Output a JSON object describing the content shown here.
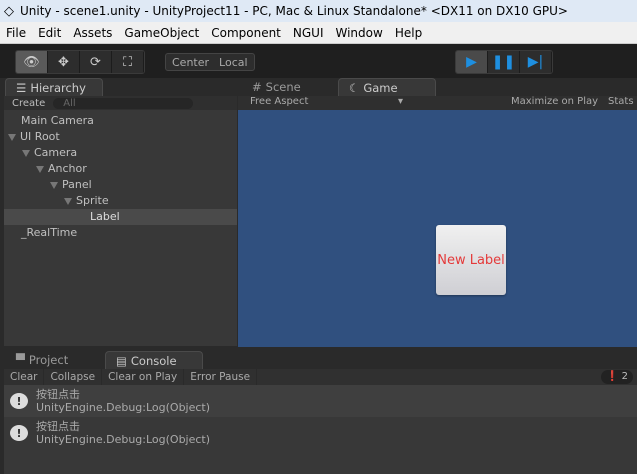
{
  "title": "Unity - scene1.unity - UnityProject11 - PC, Mac & Linux Standalone* <DX11 on DX10 GPU>",
  "menu": [
    "File",
    "Edit",
    "Assets",
    "GameObject",
    "Component",
    "NGUI",
    "Window",
    "Help"
  ],
  "toolbar": {
    "pivot": "Center",
    "space": "Local"
  },
  "hierarchy": {
    "tab": "Hierarchy",
    "create": "Create",
    "search_placeholder": "All",
    "items": [
      {
        "label": "Main Camera"
      },
      {
        "label": "UI Root"
      },
      {
        "label": "Camera"
      },
      {
        "label": "Anchor"
      },
      {
        "label": "Panel"
      },
      {
        "label": "Sprite"
      },
      {
        "label": "Label"
      },
      {
        "label": "_RealTime"
      }
    ]
  },
  "scene_tab": "Scene",
  "game_tab": "Game",
  "game": {
    "aspect": "Free Aspect",
    "maximize": "Maximize on Play",
    "stats": "Stats",
    "label_text": "New Label",
    "bg": "#30507f"
  },
  "bottom": {
    "project_tab": "Project",
    "console_tab": "Console",
    "buttons": [
      "Clear",
      "Collapse",
      "Clear on Play",
      "Error Pause"
    ],
    "count": "2",
    "logs": [
      {
        "msg": "按钮点击",
        "trace": "UnityEngine.Debug:Log(Object)"
      },
      {
        "msg": "按钮点击",
        "trace": "UnityEngine.Debug:Log(Object)"
      }
    ]
  }
}
